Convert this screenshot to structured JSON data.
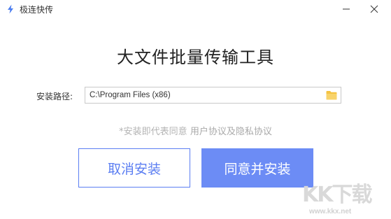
{
  "window": {
    "title": "极连快传",
    "minimize_icon": "minimize-icon",
    "close_icon": "close-icon"
  },
  "header": {
    "title": "大文件批量传输工具"
  },
  "install": {
    "path_label": "安装路径:",
    "path_value": "C:\\Program Files (x86)",
    "browse_icon": "folder-icon"
  },
  "agreement": {
    "prefix": "*安装即代表同意",
    "link_text": "用户协议及隐私协议"
  },
  "buttons": {
    "cancel_label": "取消安装",
    "install_label": "同意并安装"
  },
  "watermark": {
    "logo_text": "KK下载",
    "url": "www.kkx.net"
  },
  "colors": {
    "accent": "#5b7ef2",
    "install_button": "#6c8cf5",
    "app_icon": "#4a7cf0"
  }
}
